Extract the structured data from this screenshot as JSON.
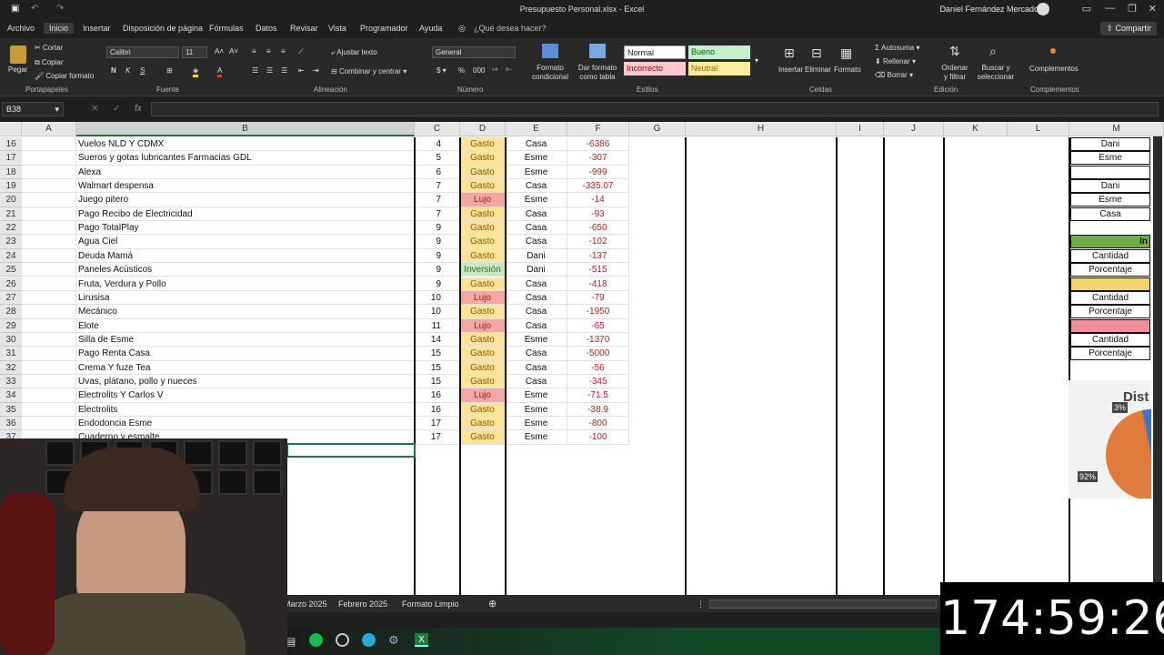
{
  "titlebar": {
    "document_title": "Presupuesto Personal.xlsx - Excel",
    "user": "Daniel Fernández Mercado"
  },
  "menu_tabs": [
    "Archivo",
    "Inicio",
    "Insertar",
    "Disposición de página",
    "Fórmulas",
    "Datos",
    "Revisar",
    "Vista",
    "Programador",
    "Ayuda"
  ],
  "tell_me": "¿Qué desea hacer?",
  "share_label": "Compartir",
  "ribbon": {
    "clipboard": {
      "paste": "Pegar",
      "cut": "Cortar",
      "copy": "Copiar",
      "format_painter": "Copiar formato",
      "group": "Portapapeles"
    },
    "font": {
      "name": "Calibri",
      "size": "11",
      "group": "Fuente",
      "bold": "N",
      "italic": "K",
      "underline": "S"
    },
    "alignment": {
      "wrap": "Ajustar texto",
      "merge": "Combinar y centrar",
      "group": "Alineación"
    },
    "number": {
      "format": "General",
      "group": "Número"
    },
    "styles": {
      "cond_format": "Formato condicional",
      "as_table": "Dar formato como tabla",
      "group": "Estilos",
      "normal": "Normal",
      "bueno": "Bueno",
      "incorrecto": "Incorrecto",
      "neutral": "Neutral"
    },
    "cells": {
      "insert": "Insertar",
      "delete": "Eliminar",
      "format": "Formato",
      "group": "Celdas"
    },
    "editing": {
      "autosum": "Autosuma",
      "fill": "Rellenar",
      "clear": "Borrar",
      "sort": "Ordenar y filtrar",
      "find": "Buscar y seleccionar",
      "group": "Edición"
    },
    "addins": {
      "label": "Complementos",
      "group": "Complementos"
    }
  },
  "name_box": "B38",
  "columns": [
    "A",
    "B",
    "C",
    "D",
    "E",
    "F",
    "G",
    "H",
    "I",
    "J",
    "K",
    "L",
    "M"
  ],
  "rows": [
    {
      "n": "16",
      "b": "Vuelos NLD Y CDMX",
      "c": "4",
      "d": "Gasto",
      "e": "Casa",
      "f": "-6386"
    },
    {
      "n": "17",
      "b": "Sueros y gotas lubricantes Farmacias GDL",
      "c": "5",
      "d": "Gasto",
      "e": "Esme",
      "f": "-307"
    },
    {
      "n": "18",
      "b": "Alexa",
      "c": "6",
      "d": "Gasto",
      "e": "Esme",
      "f": "-999"
    },
    {
      "n": "19",
      "b": "Walmart despensa",
      "c": "7",
      "d": "Gasto",
      "e": "Casa",
      "f": "-335.07"
    },
    {
      "n": "20",
      "b": "Juego pitero",
      "c": "7",
      "d": "Lujo",
      "e": "Esme",
      "f": "-14"
    },
    {
      "n": "21",
      "b": "Pago Recibo de Electricidad",
      "c": "7",
      "d": "Gasto",
      "e": "Casa",
      "f": "-93"
    },
    {
      "n": "22",
      "b": "Pago TotalPlay",
      "c": "9",
      "d": "Gasto",
      "e": "Casa",
      "f": "-650"
    },
    {
      "n": "23",
      "b": "Agua Ciel",
      "c": "9",
      "d": "Gasto",
      "e": "Casa",
      "f": "-102"
    },
    {
      "n": "24",
      "b": "Deuda Mamá",
      "c": "9",
      "d": "Gasto",
      "e": "Dani",
      "f": "-137"
    },
    {
      "n": "25",
      "b": "Paneles Acústicos",
      "c": "9",
      "d": "Inversión",
      "e": "Dani",
      "f": "-515"
    },
    {
      "n": "26",
      "b": "Fruta, Verdura y Pollo",
      "c": "9",
      "d": "Gasto",
      "e": "Casa",
      "f": "-418"
    },
    {
      "n": "27",
      "b": "Lirusisa",
      "c": "10",
      "d": "Lujo",
      "e": "Casa",
      "f": "-79"
    },
    {
      "n": "28",
      "b": "Mecánico",
      "c": "10",
      "d": "Gasto",
      "e": "Casa",
      "f": "-1950"
    },
    {
      "n": "29",
      "b": "Elote",
      "c": "11",
      "d": "Lujo",
      "e": "Casa",
      "f": "-65"
    },
    {
      "n": "30",
      "b": "Silla de Esme",
      "c": "14",
      "d": "Gasto",
      "e": "Esme",
      "f": "-1370"
    },
    {
      "n": "31",
      "b": "Pago Renta Casa",
      "c": "15",
      "d": "Gasto",
      "e": "Casa",
      "f": "-5000"
    },
    {
      "n": "32",
      "b": "Crema Y fuze Tea",
      "c": "15",
      "d": "Gasto",
      "e": "Casa",
      "f": "-56"
    },
    {
      "n": "33",
      "b": "Uvas, plátano, pollo y nueces",
      "c": "15",
      "d": "Gasto",
      "e": "Casa",
      "f": "-345"
    },
    {
      "n": "34",
      "b": "Electrolits Y Carlos V",
      "c": "16",
      "d": "Lujo",
      "e": "Esme",
      "f": "-71.5"
    },
    {
      "n": "35",
      "b": "Electrolits",
      "c": "16",
      "d": "Gasto",
      "e": "Esme",
      "f": "-38.9"
    },
    {
      "n": "36",
      "b": "Endodoncia Esme",
      "c": "17",
      "d": "Gasto",
      "e": "Esme",
      "f": "-800"
    },
    {
      "n": "37",
      "b": "Cuaderno y esmalte",
      "c": "17",
      "d": "Gasto",
      "e": "Esme",
      "f": "-100"
    }
  ],
  "side_table": {
    "r16": "Dani",
    "r17": "Esme",
    "r19": "Dani",
    "r20": "Esme",
    "r21": "Casa",
    "r23": "In",
    "r24": "Cantidad",
    "r25": "Porcentaje",
    "r27": "Cantidad",
    "r28": "Porcentaje",
    "r30": "Cantidad",
    "r31": "Porcentaje"
  },
  "pie": {
    "title": "Dist",
    "label_small": "3%",
    "label_big": "92%"
  },
  "sheet_tabs": [
    "Marzo 2025",
    "Febrero 2025",
    "Formato Limpio"
  ],
  "timer": "174:59:26",
  "colors": {
    "gasto": "#fbe39a",
    "lujo": "#f3a6a6",
    "inversion": "#c6e7c1",
    "header_green": "#70ad47",
    "accent": "#217346"
  }
}
